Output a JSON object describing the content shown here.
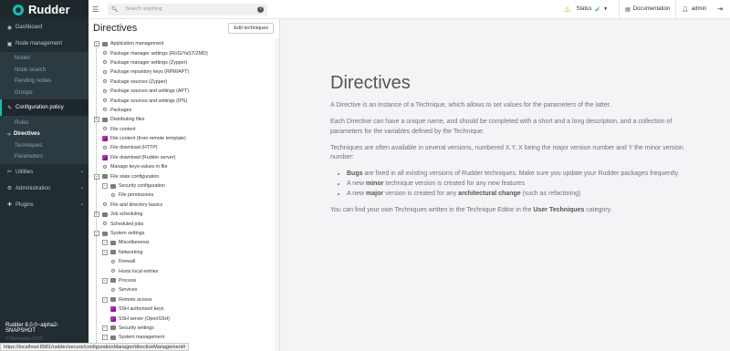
{
  "app": {
    "brand": "Rudder",
    "version": "Rudder 8.0.0~alpha2-SNAPSHOT",
    "copyright": "© Normation 2023"
  },
  "status_url": "https://localhost:8981/rudder/secure/configurationManager/directiveManagement#",
  "sidebar": {
    "dashboard": "Dashboard",
    "node_management": "Node management",
    "nodes": "Nodes",
    "node_search": "Node search",
    "pending_nodes": "Pending nodes",
    "groups": "Groups",
    "configuration_policy": "Configuration policy",
    "rules": "Rules",
    "directives": "Directives",
    "techniques": "Techniques",
    "parameters": "Parameters",
    "utilities": "Utilities",
    "administration": "Administration",
    "plugins": "Plugins"
  },
  "topbar": {
    "search_placeholder": "Search anything",
    "status": "Status",
    "documentation": "Documentation",
    "user": "admin"
  },
  "tree_panel": {
    "title": "Directives",
    "edit_button": "Edit techniques",
    "nodes": [
      {
        "label": "Application management",
        "type": "category",
        "level": 0
      },
      {
        "label": "Package manager settings (RUG/YaST/ZMD)",
        "type": "technique",
        "level": 1
      },
      {
        "label": "Package manager settings (Zypper)",
        "type": "technique",
        "level": 1
      },
      {
        "label": "Package repository keys (RPM/APT)",
        "type": "technique",
        "level": 1
      },
      {
        "label": "Package sources (Zypper)",
        "type": "technique",
        "level": 1
      },
      {
        "label": "Package sources and settings (APT)",
        "type": "technique",
        "level": 1
      },
      {
        "label": "Package sources and settings (IPS)",
        "type": "technique",
        "level": 1
      },
      {
        "label": "Packages",
        "type": "technique",
        "level": 1
      },
      {
        "label": "Distributing files",
        "type": "category",
        "level": 0
      },
      {
        "label": "File content",
        "type": "technique",
        "level": 1
      },
      {
        "label": "File content (from remote template)",
        "type": "plugin",
        "level": 1
      },
      {
        "label": "File download (HTTP)",
        "type": "technique",
        "level": 1
      },
      {
        "label": "File download (Rudder server)",
        "type": "plugin",
        "level": 1
      },
      {
        "label": "Manage keys-values in file",
        "type": "technique",
        "level": 1
      },
      {
        "label": "File state configuration",
        "type": "category",
        "level": 0
      },
      {
        "label": "Security configuration",
        "type": "category",
        "level": 1
      },
      {
        "label": "File permissions",
        "type": "technique",
        "level": 2
      },
      {
        "label": "File and directory basics",
        "type": "technique",
        "level": 1
      },
      {
        "label": "Job scheduling",
        "type": "category",
        "level": 0
      },
      {
        "label": "Scheduled jobs",
        "type": "technique",
        "level": 1
      },
      {
        "label": "System settings",
        "type": "category",
        "level": 0
      },
      {
        "label": "Miscellaneous",
        "type": "category",
        "level": 1
      },
      {
        "label": "Networking",
        "type": "category",
        "level": 1
      },
      {
        "label": "Firewall",
        "type": "technique",
        "level": 2
      },
      {
        "label": "Hosts local entries",
        "type": "technique",
        "level": 2
      },
      {
        "label": "Process",
        "type": "category",
        "level": 1
      },
      {
        "label": "Services",
        "type": "technique",
        "level": 2
      },
      {
        "label": "Remote access",
        "type": "category",
        "level": 1
      },
      {
        "label": "SSH authorised keys",
        "type": "plugin",
        "level": 2
      },
      {
        "label": "SSH server (OpenSSH)",
        "type": "plugin",
        "level": 2
      },
      {
        "label": "Security settings",
        "type": "category",
        "level": 1
      },
      {
        "label": "System management",
        "type": "category",
        "level": 1
      }
    ]
  },
  "main": {
    "title": "Directives",
    "p1": "A Directive is an instance of a Technique, which allows to set values for the parameters of the latter.",
    "p2": "Each Directive can have a unique name, and should be completed with a short and a long description, and a collection of parameters for the variables defined by the Technique.",
    "p3": "Techniques are often available in several versions, numbered X.Y, X being the major version number and Y the minor version number:",
    "li1_bold": "Bugs",
    "li1_rest": " are fixed in all existing versions of Rudder techniques. Make sure you update your Rudder packages frequently.",
    "li2_pre": "A new ",
    "li2_bold": "minor",
    "li2_rest": " technique version is created for any new features",
    "li3_pre": "A new ",
    "li3_bold": "major",
    "li3_mid": " version is created for any ",
    "li3_bold2": "architectural change",
    "li3_rest": " (such as refactoring)",
    "p4_pre": "You can find your own Techniques written in the Technique Editor in the ",
    "p4_bold": "User Techniques",
    "p4_rest": " category."
  },
  "colors": {
    "sidebar_bg": "#222d32",
    "accent": "#13beb7",
    "warning": "#f0a40e",
    "plugin": "#c32ab8"
  }
}
